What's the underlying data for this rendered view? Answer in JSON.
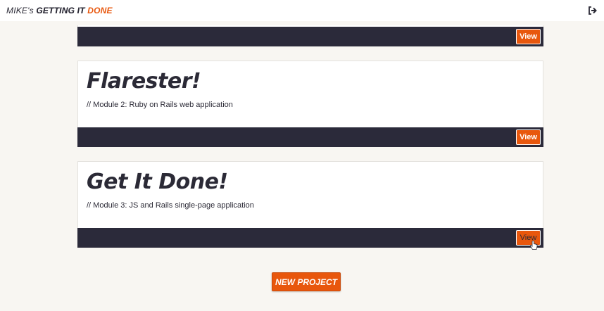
{
  "header": {
    "brand_part1": "MIKE's ",
    "brand_part2": "GETTING IT ",
    "brand_part3": "DONE",
    "logout_icon": "sign-out-icon"
  },
  "projects": [
    {
      "title": "",
      "description": "",
      "view_label": "View"
    },
    {
      "title": "Flarester!",
      "description": "// Module 2: Ruby on Rails web application",
      "view_label": "View"
    },
    {
      "title": "Get It Done!",
      "description": "// Module 3: JS and Rails single-page application",
      "view_label": "View"
    }
  ],
  "new_project_label": "NEW PROJECT",
  "colors": {
    "accent": "#e8570d",
    "dark": "#2b2a3a",
    "background": "#f8f6f2"
  }
}
